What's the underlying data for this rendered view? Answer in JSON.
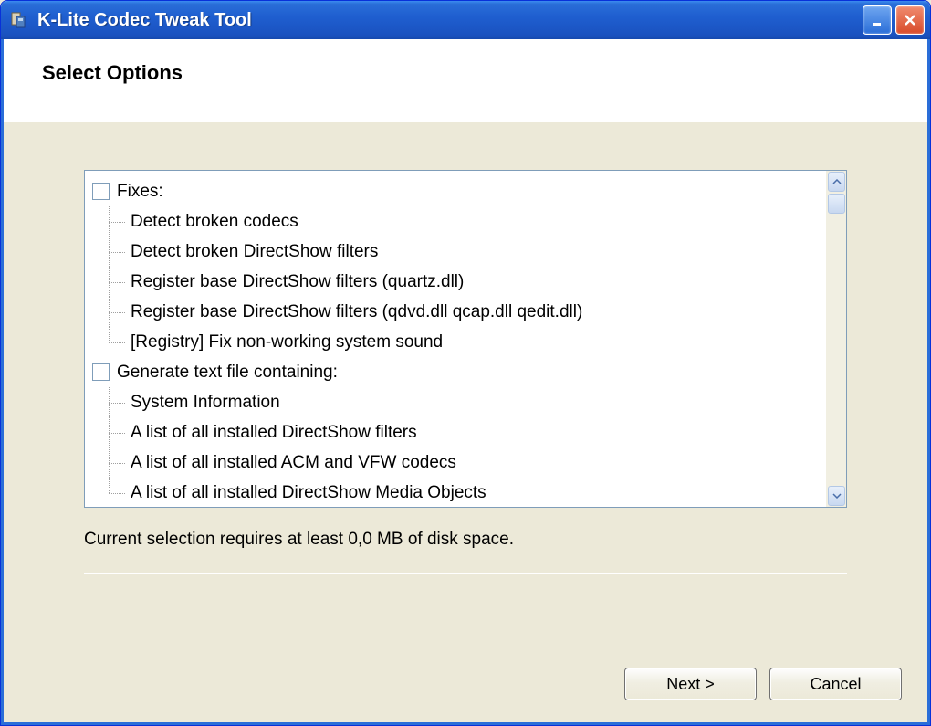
{
  "window": {
    "title": "K-Lite Codec Tweak Tool"
  },
  "heading": "Select Options",
  "tree": {
    "groups": [
      {
        "label": "Fixes:",
        "items": [
          "Detect broken codecs",
          "Detect broken DirectShow filters",
          "Register base DirectShow filters (quartz.dll)",
          "Register base DirectShow filters (qdvd.dll qcap.dll qedit.dll)",
          "[Registry] Fix non-working system sound"
        ]
      },
      {
        "label": "Generate text file containing:",
        "items": [
          "System Information",
          "A list of all installed DirectShow filters",
          "A list of all installed ACM and VFW codecs",
          "A list of all installed DirectShow Media Objects"
        ]
      }
    ]
  },
  "status": "Current selection requires at least 0,0 MB of disk space.",
  "buttons": {
    "next": "Next >",
    "cancel": "Cancel"
  }
}
